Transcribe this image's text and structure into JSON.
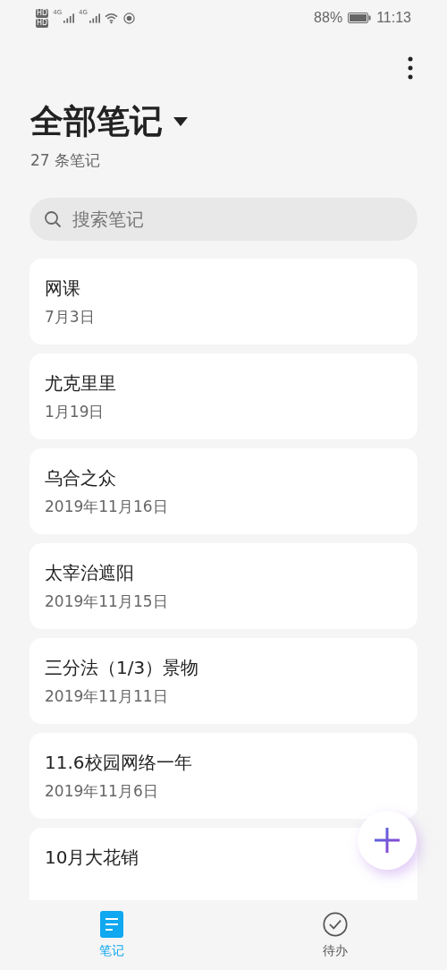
{
  "status_bar": {
    "hd_badges": [
      "HD",
      "HD"
    ],
    "networks": [
      "4G",
      "4G"
    ],
    "battery": "88%",
    "time": "11:13"
  },
  "header": {
    "title": "全部笔记",
    "count": "27 条笔记"
  },
  "search": {
    "placeholder": "搜索笔记"
  },
  "notes": [
    {
      "title": "网课",
      "date": "7月3日"
    },
    {
      "title": "尤克里里",
      "date": "1月19日"
    },
    {
      "title": "乌合之众",
      "date": "2019年11月16日"
    },
    {
      "title": "太宰治遮阳",
      "date": "2019年11月15日"
    },
    {
      "title": "三分法（1/3）景物",
      "date": "2019年11月11日"
    },
    {
      "title": "11.6校园网络一年",
      "date": "2019年11月6日"
    },
    {
      "title": "10月大花销"
    }
  ],
  "tabs": [
    {
      "kind": "notes",
      "label": "笔记",
      "selected": true
    },
    {
      "kind": "todo",
      "label": "待办",
      "selected": false
    }
  ]
}
